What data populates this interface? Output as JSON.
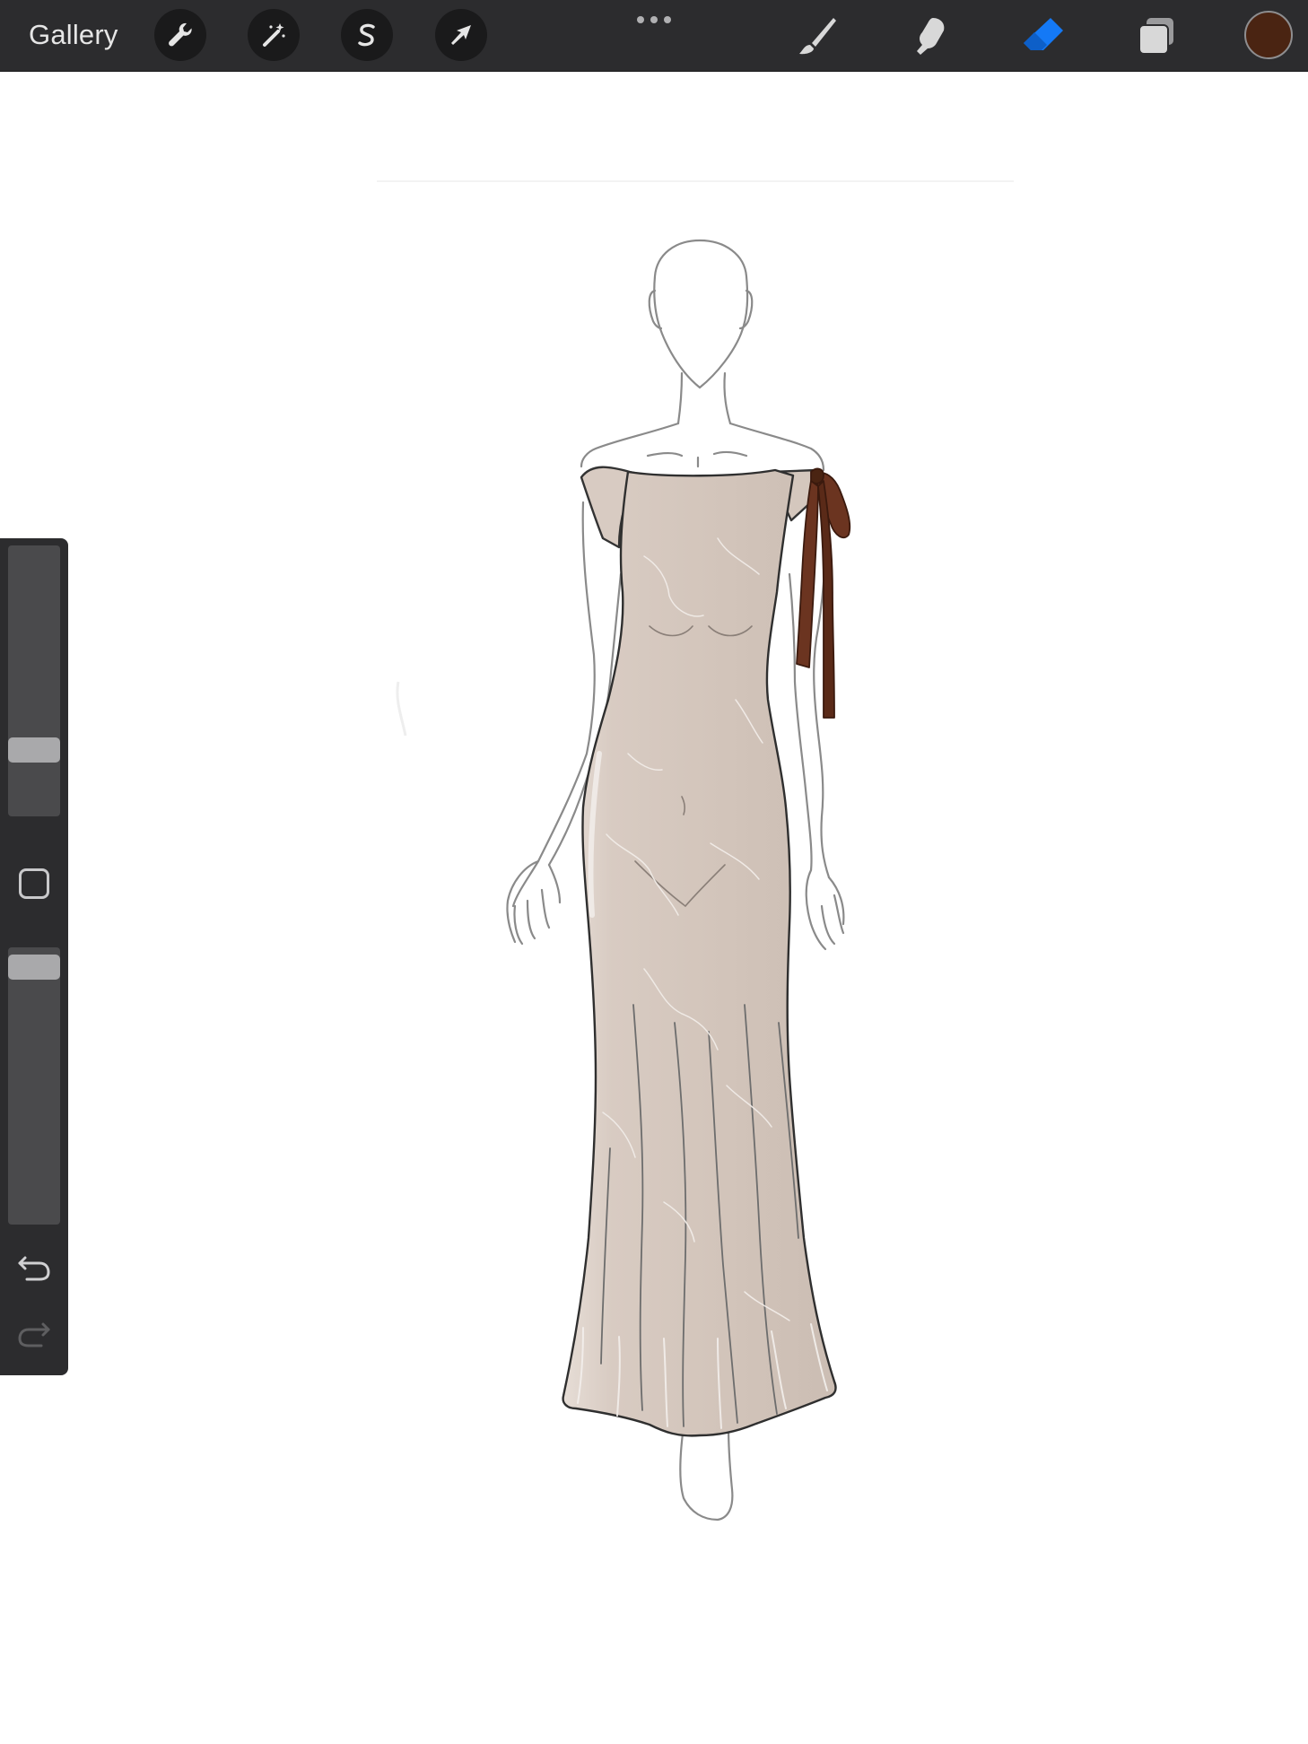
{
  "toolbar": {
    "gallery_label": "Gallery",
    "left_tools": [
      {
        "name": "actions",
        "icon": "wrench-icon"
      },
      {
        "name": "adjustments",
        "icon": "magic-wand-icon"
      },
      {
        "name": "selection",
        "icon": "selection-s-icon"
      },
      {
        "name": "transform",
        "icon": "arrow-cursor-icon"
      }
    ],
    "more_icon": "more-dots-icon",
    "right_tools": [
      {
        "name": "brush",
        "icon": "brush-icon",
        "active": false
      },
      {
        "name": "smudge",
        "icon": "smudge-finger-icon",
        "active": false
      },
      {
        "name": "eraser",
        "icon": "eraser-icon",
        "active": true
      },
      {
        "name": "layers",
        "icon": "layers-icon",
        "active": false
      }
    ],
    "current_color": "#4a2412",
    "active_color": "#1479f6"
  },
  "sidebar": {
    "brush_size_level": 0.22,
    "opacity_level": 0.97,
    "modify_icon": "square-modify-icon",
    "undo_icon": "undo-arrow-icon",
    "redo_icon": "redo-arrow-icon"
  },
  "canvas": {
    "subject": "fashion-croquis-dress",
    "dress_color": "#d4c7bd",
    "ribbon_color": "#6b3420",
    "line_color": "#555555"
  }
}
